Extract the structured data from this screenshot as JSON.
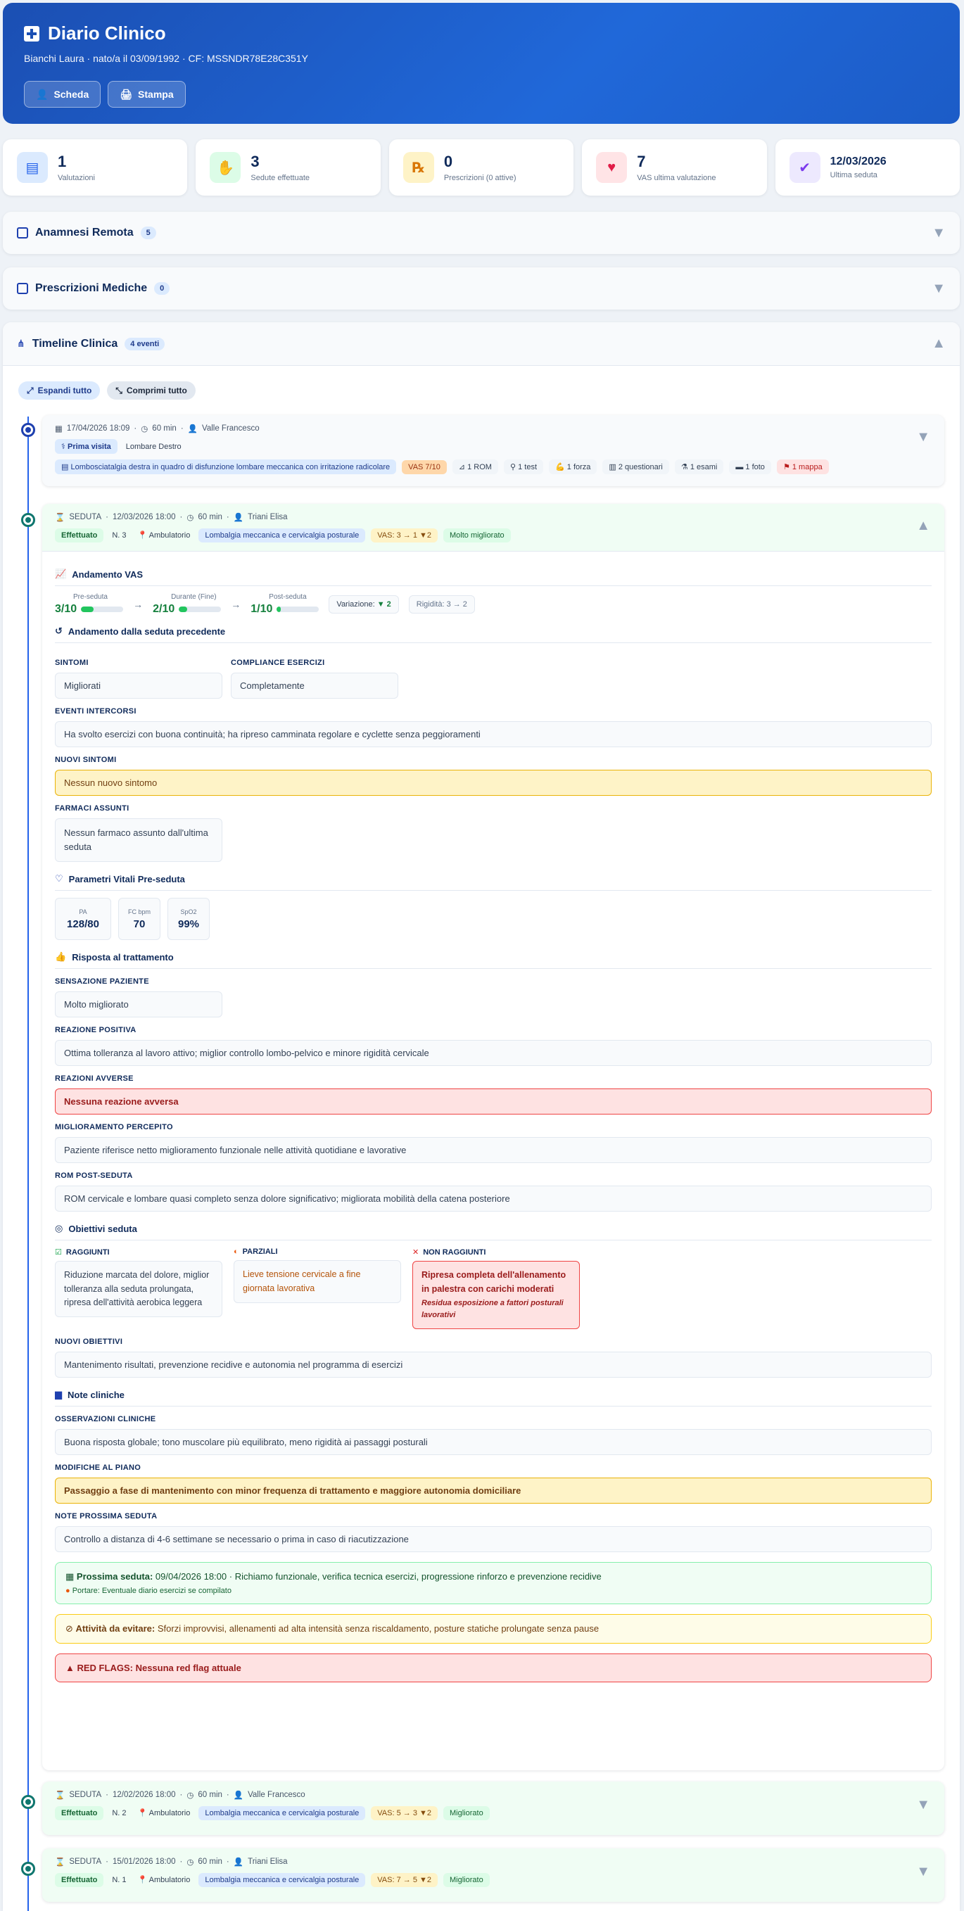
{
  "header": {
    "title": "Diario Clinico",
    "patient_name": "Bianchi Laura",
    "birth": "nato/a il 03/09/1992",
    "cf": "CF: MSSNDR78E28C351Y",
    "btn_scheda": "Scheda",
    "btn_stampa": "Stampa"
  },
  "stats": [
    {
      "value": "1",
      "label": "Valutazioni",
      "icon": "clipboard-icon",
      "color": "#2563eb"
    },
    {
      "value": "3",
      "label": "Sedute effettuate",
      "icon": "handshake-icon",
      "color": "#16a34a"
    },
    {
      "value": "0",
      "label": "Prescrizioni (0 attive)",
      "icon": "prescription-icon",
      "color": "#d97706"
    },
    {
      "value": "7",
      "label": "VAS ultima valutazione",
      "icon": "heart-pulse-icon",
      "color": "#e11d48"
    },
    {
      "value": "12/03/2026",
      "label": "Ultima seduta",
      "icon": "calendar-check-icon",
      "color": "#7c3aed"
    }
  ],
  "sections": {
    "anamnesi": {
      "title": "Anamnesi Remota",
      "count": "5"
    },
    "prescrizioni": {
      "title": "Prescrizioni Mediche",
      "count": "0"
    },
    "timeline": {
      "title": "Timeline Clinica",
      "count": "4 eventi"
    }
  },
  "controls": {
    "expand": "Espandi tutto",
    "collapse": "Comprimi tutto"
  },
  "event1": {
    "date": "17/04/2026 18:09",
    "duration": "60 min",
    "operator": "Valle Francesco",
    "type": "Prima visita",
    "region": "Lombare Destro",
    "diagnosis": "Lombosciatalgia destra in quadro di disfunzione lombare meccanica con irritazione radicolare",
    "vas": "VAS 7/10",
    "rom": "1 ROM",
    "test": "1 test",
    "forza": "1 forza",
    "questionari": "2 questionari",
    "esami": "1 esami",
    "foto": "1 foto",
    "mappa": "1 mappa"
  },
  "event2": {
    "kind": "SEDUTA",
    "date": "12/03/2026 18:00",
    "duration": "60 min",
    "operator": "Triani Elisa",
    "status": "Effettuato",
    "number": "N. 3",
    "place": "Ambulatorio",
    "diagnosis": "Lombalgia meccanica e cervicalgia posturale",
    "vas": "VAS: 3 → 1 ▼2",
    "outcome": "Molto migliorato",
    "vas_title": "Andamento VAS",
    "vas_pre_cap": "Pre-seduta",
    "vas_pre": "3/10",
    "vas_pre_level": 0.3,
    "vas_mid_cap": "Durante (Fine)",
    "vas_mid": "2/10",
    "vas_mid_level": 0.2,
    "vas_post_cap": "Post-seduta",
    "vas_post": "1/10",
    "vas_post_level": 0.1,
    "variation_label": "Variazione:",
    "variation_value": "▼ 2",
    "rigidity": "Rigidità: 3 → 2",
    "prev_title": "Andamento dalla seduta precedente",
    "sintomi_lbl": "SINTOMI",
    "sintomi": "Migliorati",
    "compliance_lbl": "COMPLIANCE ESERCIZI",
    "compliance": "Completamente",
    "eventi_lbl": "EVENTI INTERCORSI",
    "eventi": "Ha svolto esercizi con buona continuità; ha ripreso camminata regolare e cyclette senza peggioramenti",
    "nuovi_sintomi_lbl": "NUOVI SINTOMI",
    "nuovi_sintomi": "Nessun nuovo sintomo",
    "farmaci_lbl": "FARMACI ASSUNTI",
    "farmaci": "Nessun farmaco assunto dall'ultima seduta",
    "vitali_title": "Parametri Vitali Pre-seduta",
    "pa_cap": "PA",
    "pa": "128/80",
    "fc_cap": "FC bpm",
    "fc": "70",
    "spo2_cap": "SpO2",
    "spo2": "99%",
    "risposta_title": "Risposta al trattamento",
    "sensazione_lbl": "SENSAZIONE PAZIENTE",
    "sensazione": "Molto migliorato",
    "positiva_lbl": "REAZIONE POSITIVA",
    "positiva": "Ottima tolleranza al lavoro attivo; miglior controllo lombo-pelvico e minore rigidità cervicale",
    "avverse_lbl": "REAZIONI AVVERSE",
    "avverse": "Nessuna reazione avversa",
    "percepito_lbl": "MIGLIORAMENTO PERCEPITO",
    "percepito": "Paziente riferisce netto miglioramento funzionale nelle attività quotidiane e lavorative",
    "rom_lbl": "ROM POST-SEDUTA",
    "rom": "ROM cervicale e lombare quasi completo senza dolore significativo; migliorata mobilità della catena posteriore",
    "obiettivi_title": "Obiettivi seduta",
    "raggiunti_lbl": "RAGGIUNTI",
    "raggiunti": "Riduzione marcata del dolore, miglior tolleranza alla seduta prolungata, ripresa dell'attività aerobica leggera",
    "parziali_lbl": "PARZIALI",
    "parziali": "Lieve tensione cervicale a fine giornata lavorativa",
    "non_raggiunti_lbl": "NON RAGGIUNTI",
    "non_raggiunti": "Ripresa completa dell'allenamento in palestra con carichi moderati",
    "non_raggiunti_note": "Residua esposizione a fattori posturali lavorativi",
    "nuovi_obiettivi_lbl": "NUOVI OBIETTIVI",
    "nuovi_obiettivi": "Mantenimento risultati, prevenzione recidive e autonomia nel programma di esercizi",
    "note_title": "Note cliniche",
    "osservazioni_lbl": "OSSERVAZIONI CLINICHE",
    "osservazioni": "Buona risposta globale; tono muscolare più equilibrato, meno rigidità ai passaggi posturali",
    "modifiche_lbl": "MODIFICHE AL PIANO",
    "modifiche": "Passaggio a fase di mantenimento con minor frequenza di trattamento e maggiore autonomia domiciliare",
    "prossima_lbl": "NOTE PROSSIMA SEDUTA",
    "prossima": "Controllo a distanza di 4-6 settimane se necessario o prima in caso di riacutizzazione",
    "next_label": "Prossima seduta:",
    "next_date": "09/04/2026 18:00",
    "next_desc": "Richiamo funzionale, verifica tecnica esercizi, progressione rinforzo e prevenzione recidive",
    "next_bring": "Portare: Eventuale diario esercizi se compilato",
    "avoid_label": "Attività da evitare:",
    "avoid": "Sforzi improvvisi, allenamenti ad alta intensità senza riscaldamento, posture statiche prolungate senza pause",
    "redflag_label": "RED FLAGS:",
    "redflag": "Nessuna red flag attuale"
  },
  "event3": {
    "kind": "SEDUTA",
    "date": "12/02/2026 18:00",
    "duration": "60 min",
    "operator": "Valle Francesco",
    "status": "Effettuato",
    "number": "N. 2",
    "place": "Ambulatorio",
    "diagnosis": "Lombalgia meccanica e cervicalgia posturale",
    "vas": "VAS: 5 → 3 ▼2",
    "outcome": "Migliorato"
  },
  "event4": {
    "kind": "SEDUTA",
    "date": "15/01/2026 18:00",
    "duration": "60 min",
    "operator": "Triani Elisa",
    "status": "Effettuato",
    "number": "N. 1",
    "place": "Ambulatorio",
    "diagnosis": "Lombalgia meccanica e cervicalgia posturale",
    "vas": "VAS: 7 → 5 ▼2",
    "outcome": "Migliorato"
  }
}
